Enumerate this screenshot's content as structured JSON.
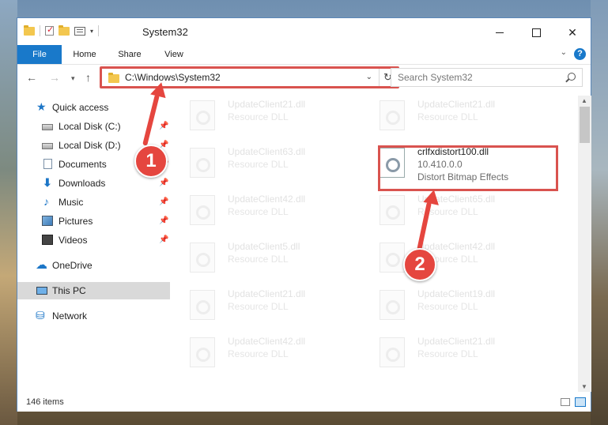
{
  "window": {
    "title": "System32"
  },
  "ribbon": {
    "tabs": [
      {
        "label": "File"
      },
      {
        "label": "Home"
      },
      {
        "label": "Share"
      },
      {
        "label": "View"
      }
    ]
  },
  "address": {
    "path": "C:\\Windows\\System32",
    "search_placeholder": "Search System32"
  },
  "nav": {
    "items": [
      {
        "label": "Quick access"
      },
      {
        "label": "Local Disk (C:)"
      },
      {
        "label": "Local Disk (D:)"
      },
      {
        "label": "Documents"
      },
      {
        "label": "Downloads"
      },
      {
        "label": "Music"
      },
      {
        "label": "Pictures"
      },
      {
        "label": "Videos"
      },
      {
        "label": "OneDrive"
      },
      {
        "label": "This PC"
      },
      {
        "label": "Network"
      }
    ]
  },
  "files": {
    "left": [
      {
        "name": "UpdateClient21.dll",
        "desc": "Resource DLL"
      },
      {
        "name": "UpdateClient63.dll",
        "desc": "Resource DLL"
      },
      {
        "name": "UpdateClient42.dll",
        "desc": "Resource DLL"
      },
      {
        "name": "UpdateClient5.dll",
        "desc": "Resource DLL"
      },
      {
        "name": "UpdateClient21.dll",
        "desc": "Resource DLL"
      },
      {
        "name": "UpdateClient42.dll",
        "desc": "Resource DLL"
      }
    ],
    "right": [
      {
        "name": "UpdateClient21.dll",
        "desc": "Resource DLL"
      },
      {
        "name": "UpdateClient65.dll",
        "desc": "Resource DLL"
      },
      {
        "name": "UpdateClient42.dll",
        "desc": "Resource DLL"
      },
      {
        "name": "UpdateClient19.dll",
        "desc": "Resource DLL"
      },
      {
        "name": "UpdateClient21.dll",
        "desc": "Resource DLL"
      }
    ],
    "highlighted": {
      "name": "crlfxdistort100.dll",
      "version": "10.410.0.0",
      "desc": "Distort Bitmap Effects"
    }
  },
  "status": {
    "count": "146 items"
  },
  "annotations": {
    "step1": "1",
    "step2": "2"
  },
  "colors": {
    "accent": "#1979ca",
    "highlight": "#d9534f",
    "annotation": "#e5463f"
  }
}
